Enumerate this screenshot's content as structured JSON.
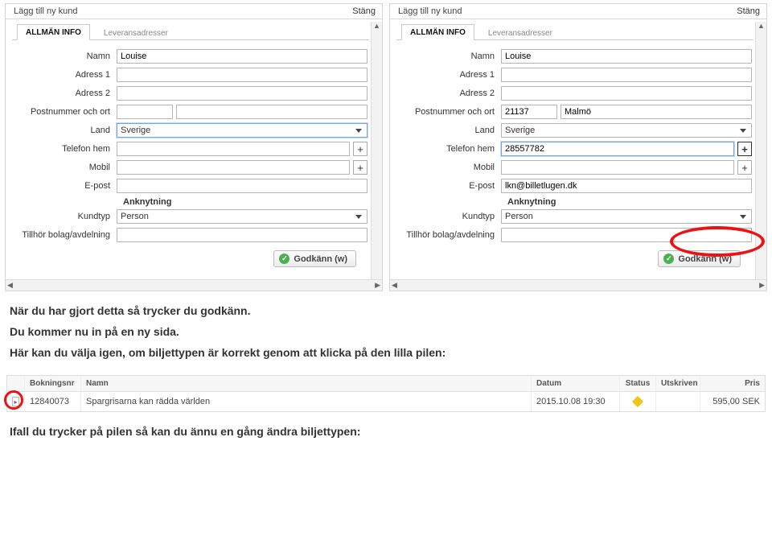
{
  "pane_header": {
    "title": "Lägg till ny kund",
    "close": "Stäng"
  },
  "tabs": {
    "general": "ALLMÄN INFO",
    "delivery": "Leveransadresser"
  },
  "labels": {
    "name": "Namn",
    "address1": "Adress 1",
    "address2": "Adress 2",
    "postcode_city": "Postnummer och ort",
    "country": "Land",
    "phone_home": "Telefon hem",
    "mobile": "Mobil",
    "email": "E-post",
    "section_attach": "Anknytning",
    "cust_type": "Kundtyp",
    "company_dept": "Tillhör bolag/avdelning"
  },
  "left_form": {
    "name": "Louise",
    "address1": "",
    "address2": "",
    "postcode": "",
    "city": "",
    "country": "Sverige",
    "phone_home": "",
    "mobile": "",
    "email": "",
    "cust_type": "Person",
    "company_dept": ""
  },
  "right_form": {
    "name": "Louise",
    "address1": "",
    "address2": "",
    "postcode": "21137",
    "city": "Malmö",
    "country": "Sverige",
    "phone_home": "28557782",
    "mobile": "",
    "email": "lkn@billetlugen.dk",
    "cust_type": "Person",
    "company_dept": ""
  },
  "approve_label": "Godkänn (w)",
  "doc_text": {
    "p1": "När du har gjort detta så trycker du godkänn.",
    "p2": "Du kommer nu in på en ny sida.",
    "p3": "Här kan du välja igen, om biljettypen är korrekt genom att klicka på den lilla pilen:",
    "p4": "Ifall du trycker på pilen så kan du ännu en gång ändra biljettypen:"
  },
  "booking_table": {
    "headers": {
      "boknr": "Bokningsnr",
      "namn": "Namn",
      "datum": "Datum",
      "status": "Status",
      "utskriven": "Utskriven",
      "pris": "Pris"
    },
    "row": {
      "boknr": "12840073",
      "namn": "Spargrisarna kan rädda världen",
      "datum": "2015.10.08 19:30",
      "pris": "595,00 SEK"
    }
  },
  "icons": {
    "plus": "+",
    "check": "✓",
    "caret_left": "◀",
    "caret_right": "▶",
    "caret_up": "▲"
  }
}
